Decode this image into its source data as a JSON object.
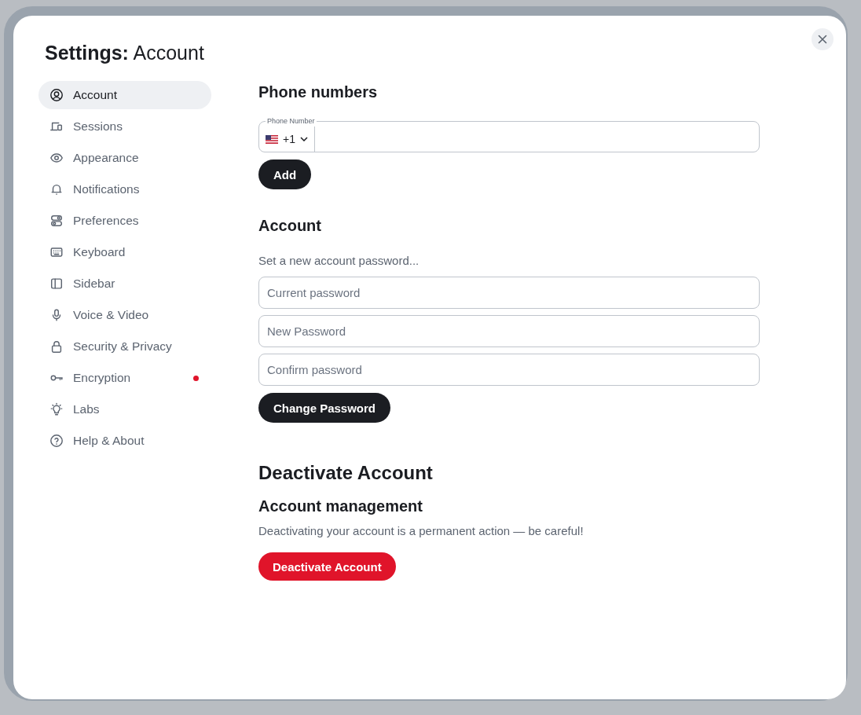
{
  "dialog": {
    "title": "**Settings:** Account"
  },
  "sidebar": {
    "items": [
      {
        "label": "Account",
        "selected": true,
        "notification": false
      },
      {
        "label": "Sessions",
        "selected": false,
        "notification": false
      },
      {
        "label": "Appearance",
        "selected": false,
        "notification": false
      },
      {
        "label": "Notifications",
        "selected": false,
        "notification": false
      },
      {
        "label": "Preferences",
        "selected": false,
        "notification": false
      },
      {
        "label": "Keyboard",
        "selected": false,
        "notification": false
      },
      {
        "label": "Sidebar",
        "selected": false,
        "notification": false
      },
      {
        "label": "Voice & Video",
        "selected": false,
        "notification": false
      },
      {
        "label": "Security & Privacy",
        "selected": false,
        "notification": false
      },
      {
        "label": "Encryption",
        "selected": false,
        "notification": true
      },
      {
        "label": "Labs",
        "selected": false,
        "notification": false
      },
      {
        "label": "Help & About",
        "selected": false,
        "notification": false
      }
    ]
  },
  "phone_numbers": {
    "heading": "Phone numbers",
    "field_label": "Phone Number",
    "country_code": "+1",
    "button": "Add"
  },
  "account": {
    "heading": "Account",
    "description": "Set a new account password...",
    "fields": [
      {
        "placeholder": "Current password"
      },
      {
        "placeholder": "New Password"
      },
      {
        "placeholder": "Confirm password"
      }
    ],
    "button": "Change Password"
  },
  "deactivate": {
    "heading": "Deactivate Account",
    "subheading": "Account management",
    "description": "Deactivating your account is a permanent action — be careful!",
    "button": "Deactivate Account"
  }
}
